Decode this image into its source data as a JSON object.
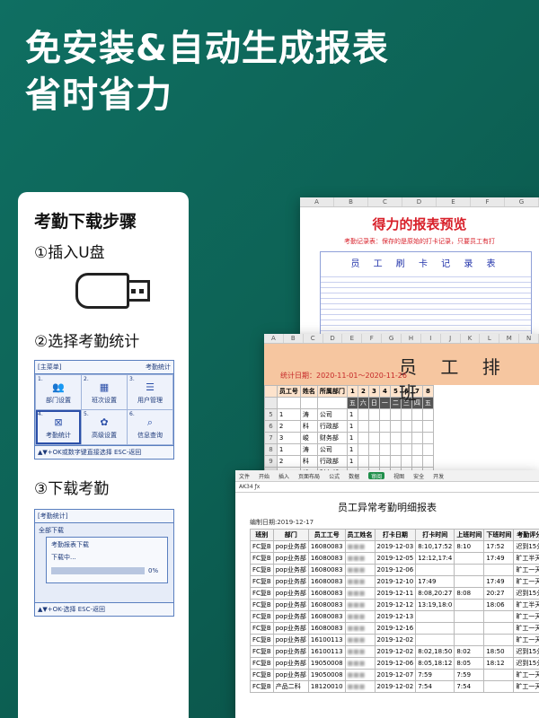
{
  "headline": {
    "line1": "免安装&自动生成报表",
    "line2": "省时省力"
  },
  "panel": {
    "title": "考勤下载步骤",
    "step1": "①插入U盘",
    "step2": "②选择考勤统计",
    "step3": "③下载考勤",
    "menu": {
      "title": "[主菜单]",
      "right": "考勤统计",
      "items": [
        {
          "num": "1.",
          "label": "部门设置",
          "icon": "people-icon"
        },
        {
          "num": "2.",
          "label": "班次设置",
          "icon": "calendar-icon"
        },
        {
          "num": "3.",
          "label": "用户管理",
          "icon": "user-manage-icon"
        },
        {
          "num": "4.",
          "label": "考勤统计",
          "icon": "excel-icon"
        },
        {
          "num": "5.",
          "label": "高级设置",
          "icon": "gear-icon"
        },
        {
          "num": "6.",
          "label": "信息查询",
          "icon": "search-doc-icon"
        }
      ],
      "footer": "▲▼+OK或数字键直接选择 ESC-返回"
    },
    "download": {
      "title": "[考勤统计]",
      "row": "全部下载",
      "dialog_title": "考勤报表下载",
      "status": "下载中...",
      "percent": "0%",
      "progress": 0,
      "footer": "▲▼+OK-选择 ESC-返回"
    }
  },
  "sheet1": {
    "cols": [
      "A",
      "B",
      "C",
      "D",
      "E",
      "F",
      "G"
    ],
    "title": "得力的报表预览",
    "subtitle": "考勤记录表：保存的是原始的打卡记录，只要员工有打",
    "card_title": "员 工 刷 卡 记 录 表"
  },
  "sheet2": {
    "cols": [
      "A",
      "B",
      "C",
      "D",
      "E",
      "F",
      "G",
      "H",
      "I",
      "J",
      "K",
      "L",
      "M",
      "N"
    ],
    "title": "员 工 排 班",
    "date": "统计日期：2020-11-01～2020-11-26",
    "headers": [
      "员工号",
      "姓名",
      "所属部门",
      "1",
      "2",
      "3",
      "4",
      "5",
      "6",
      "7",
      "8"
    ],
    "weekdays": [
      "五",
      "六",
      "日",
      "一",
      "二",
      "三",
      "四",
      "五"
    ],
    "rows": [
      {
        "rn": "5",
        "id": "1",
        "name": "涛",
        "dept": "公司",
        "v": "1"
      },
      {
        "rn": "6",
        "id": "2",
        "name": "科",
        "dept": "行政部",
        "v": "1"
      },
      {
        "rn": "7",
        "id": "3",
        "name": "峻",
        "dept": "财务部",
        "v": "1"
      },
      {
        "rn": "8",
        "id": "1",
        "name": "涛",
        "dept": "公司",
        "v": "1"
      },
      {
        "rn": "9",
        "id": "2",
        "name": "科",
        "dept": "行政部",
        "v": "1"
      },
      {
        "rn": "10",
        "id": "3",
        "name": "峻",
        "dept": "财务部",
        "v": "1"
      }
    ]
  },
  "sheet3": {
    "menu": [
      "文件",
      "开始",
      "插入",
      "页面布局",
      "公式",
      "数据",
      "审阅",
      "视图",
      "安全",
      "开发"
    ],
    "active": "审阅",
    "cellref": "AK34",
    "title": "员工异常考勤明细报表",
    "meta": "编制日期:2019-12-17",
    "headers": [
      "班别",
      "部门",
      "员工工号",
      "员工姓名",
      "打卡日期",
      "打卡时间",
      "上班时间",
      "下班时间",
      "考勤评分标准"
    ],
    "rows": [
      [
        "FC复B",
        "pop业务部",
        "16080083",
        "■■■",
        "2019-12-03",
        "8:10,17:52",
        "8:10",
        "17:52",
        "迟到15分钟内"
      ],
      [
        "FC复B",
        "pop业务部",
        "16080083",
        "■■■",
        "2019-12-05",
        "12:12,17:4",
        "",
        "17:49",
        "旷工半天"
      ],
      [
        "FC复B",
        "pop业务部",
        "16080083",
        "■■■",
        "2019-12-06",
        "",
        "",
        "",
        "旷工一天"
      ],
      [
        "FC复B",
        "pop业务部",
        "16080083",
        "■■■",
        "2019-12-10",
        "17:49",
        "",
        "17:49",
        "旷工一天"
      ],
      [
        "FC复B",
        "pop业务部",
        "16080083",
        "■■■",
        "2019-12-11",
        "8:08,20:27",
        "8:08",
        "20:27",
        "迟到15分钟内"
      ],
      [
        "FC复B",
        "pop业务部",
        "16080083",
        "■■■",
        "2019-12-12",
        "13:19,18:0",
        "",
        "18:06",
        "旷工半天"
      ],
      [
        "FC复B",
        "pop业务部",
        "16080083",
        "■■■",
        "2019-12-13",
        "",
        "",
        "",
        "旷工一天"
      ],
      [
        "FC复B",
        "pop业务部",
        "16080083",
        "■■■",
        "2019-12-16",
        "",
        "",
        "",
        "旷工一天"
      ],
      [
        "FC复B",
        "pop业务部",
        "16100113",
        "■■■",
        "2019-12-02",
        "",
        "",
        "",
        "旷工一天"
      ],
      [
        "FC复B",
        "pop业务部",
        "16100113",
        "■■■",
        "2019-12-02",
        "8:02,18:50",
        "8:02",
        "18:50",
        "迟到15分钟内"
      ],
      [
        "FC复B",
        "pop业务部",
        "19050008",
        "■■■",
        "2019-12-06",
        "8:05,18:12",
        "8:05",
        "18:12",
        "迟到15分钟内"
      ],
      [
        "FC复B",
        "pop业务部",
        "19050008",
        "■■■",
        "2019-12-07",
        "7:59",
        "7:59",
        "",
        "旷工一天"
      ],
      [
        "FC复B",
        "产品二科",
        "18120010",
        "■■■",
        "2019-12-02",
        "7:54",
        "7:54",
        "",
        "旷工一天"
      ]
    ]
  }
}
